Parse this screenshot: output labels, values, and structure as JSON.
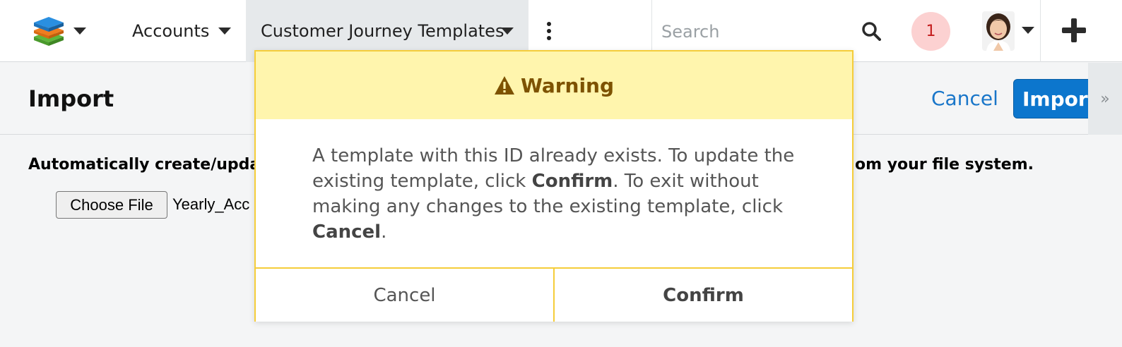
{
  "nav": {
    "logo_icon": "stacked-layers-logo",
    "tabs": [
      {
        "label": "Accounts",
        "active": false
      },
      {
        "label": "Customer Journey Templates",
        "active": true
      }
    ],
    "more_icon": "kebab-icon",
    "search": {
      "placeholder": "Search",
      "value": ""
    },
    "notifications": {
      "count": "1"
    },
    "add_icon": "plus-icon"
  },
  "page": {
    "title": "Import",
    "cancel_label": "Cancel",
    "import_label": "Import",
    "side_toggle": "»"
  },
  "body": {
    "instruction_left": "Automatically create/updat",
    "instruction_right": "om your file system.",
    "choose_file_label": "Choose File",
    "file_name": "Yearly_Acc"
  },
  "modal": {
    "title": "Warning",
    "message": {
      "part1": "A template with this ID already exists. To update the existing template, click ",
      "confirm_word": "Confirm",
      "part2": ". To exit without making any changes to the existing template, click ",
      "cancel_word": "Cancel",
      "part3": "."
    },
    "cancel_label": "Cancel",
    "confirm_label": "Confirm"
  },
  "colors": {
    "accent_blue": "#0c76cd",
    "link_blue": "#1976c9",
    "warning_header_bg": "#fff5ad",
    "warning_border": "#f5cd3a",
    "warning_text": "#7d5200",
    "notif_bg": "#fcd1d1",
    "notif_text": "#c41d1d"
  }
}
